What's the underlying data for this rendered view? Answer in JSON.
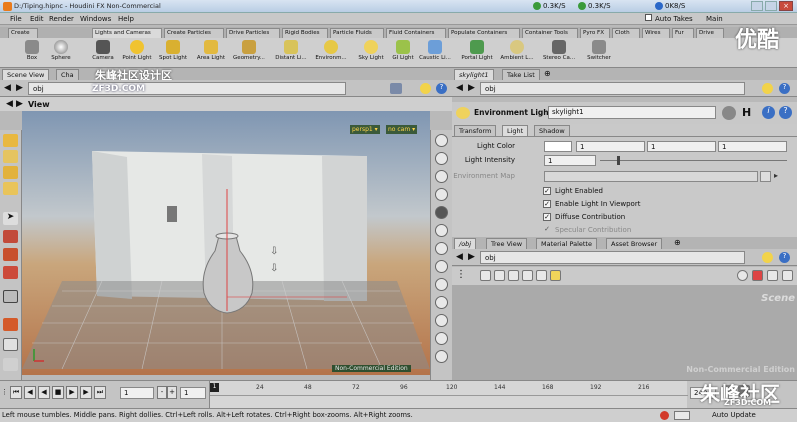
{
  "window": {
    "title": "D:/Tiping.hipnc - Houdini FX Non-Commercial",
    "net_down": "0.3K/S",
    "net_up": "0.3K/S",
    "net_other": "0K8/S",
    "auto_takes": "Auto Takes",
    "main": "Main"
  },
  "menu": [
    "File",
    "Edit",
    "Render",
    "Windows",
    "Help"
  ],
  "shelf": {
    "tabs": [
      "Create",
      "Lights and Cameras",
      "Create Particles",
      "Drive Particles",
      "Rigid Bodies",
      "Particle Fluids",
      "Fluid Containers",
      "Populate Containers",
      "Container Tools",
      "Pyro FX",
      "Cloth",
      "Wires",
      "Fur",
      "Drive"
    ],
    "tools": [
      "Box",
      "Sphere",
      "Camera",
      "Point Light",
      "Spot Light",
      "Area Light",
      "Geometry...",
      "Distant Li...",
      "Environm...",
      "Sky Light",
      "GI Light",
      "Caustic Li...",
      "Portal Light",
      "Ambient L...",
      "Stereo Ca...",
      "Switcher"
    ]
  },
  "left_panel": {
    "tabs": [
      "Scene View",
      "Cha"
    ],
    "path": "obj",
    "view_title": "View",
    "persp": "persp1 ▾",
    "cam": "no cam ▾",
    "watermark_top": "朱峰社区设计区",
    "watermark_site": "ZF3D.COM",
    "ncbadge": "Non-Commercial Edition"
  },
  "params": {
    "tabs": [
      "skylight1",
      "Take List"
    ],
    "path": "obj",
    "node_type": "Environment Light",
    "node_name": "skylight1",
    "sub_tabs": [
      "Transform",
      "Light",
      "Shadow"
    ],
    "light_color_label": "Light Color",
    "light_color": [
      "1",
      "1",
      "1"
    ],
    "intensity_label": "Light Intensity",
    "intensity": "1",
    "envmap_label": "Environment Map",
    "checks": [
      {
        "label": "Light Enabled",
        "checked": true
      },
      {
        "label": "Enable Light In Viewport",
        "checked": true
      },
      {
        "label": "Diffuse Contribution",
        "checked": true
      },
      {
        "label": "Specular Contribution",
        "checked": true
      }
    ]
  },
  "network": {
    "tabs": [
      "/obj",
      "Tree View",
      "Material Palette",
      "Asset Browser"
    ],
    "path": "obj",
    "scene_label": "Scene",
    "ncbadge": "Non-Commercial Edition"
  },
  "timeline": {
    "start": "1",
    "current": "1",
    "end": "240",
    "ticks": [
      "1",
      "24",
      "48",
      "72",
      "96",
      "120",
      "144",
      "168",
      "192",
      "216"
    ],
    "auto_update": "Auto Update"
  },
  "status": "Left mouse tumbles. Middle pans. Right dollies. Ctrl+Left rolls. Alt+Left rotates. Ctrl+Right box-zooms. Alt+Right zooms.",
  "watermark": {
    "brand": "优酷",
    "corner": "朱峰社区",
    "corner_site": "ZF3D.COM"
  },
  "colors": {
    "accent": "#3a6fc4",
    "help": "#2a5fd0",
    "viewport_floor": "#b4734a"
  }
}
